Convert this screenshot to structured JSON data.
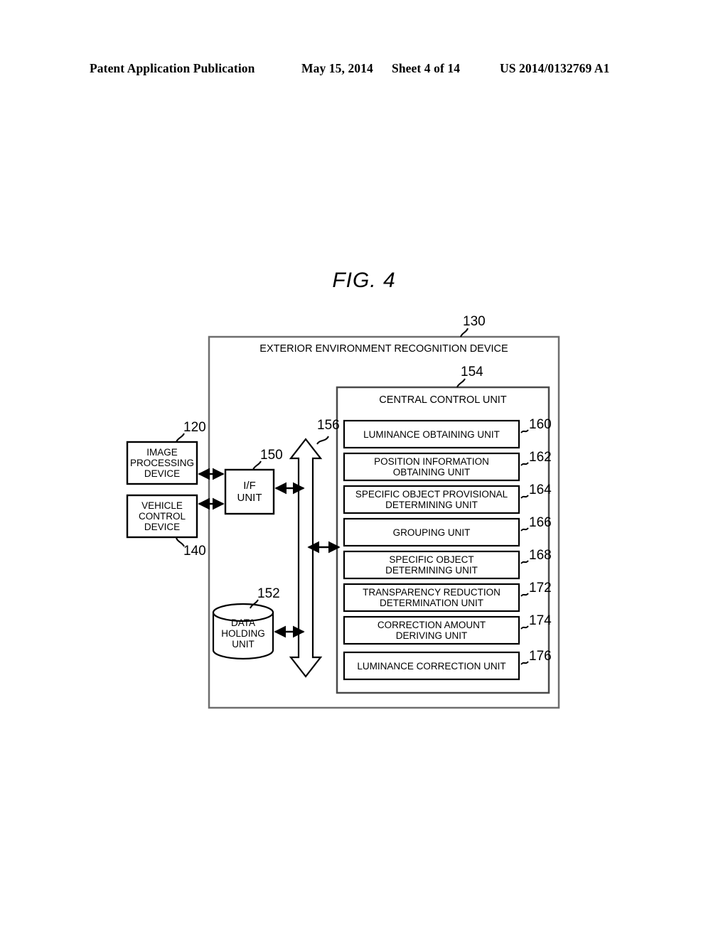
{
  "header": {
    "publication": "Patent Application Publication",
    "date": "May 15, 2014",
    "sheet": "Sheet 4 of 14",
    "patent_number": "US 2014/0132769 A1"
  },
  "figure": {
    "title": "FIG. 4",
    "outer_device": {
      "label": "EXTERIOR ENVIRONMENT RECOGNITION DEVICE",
      "ref": "130"
    },
    "external_blocks": [
      {
        "label": "IMAGE\nPROCESSING\nDEVICE",
        "ref": "120"
      },
      {
        "label": "VEHICLE\nCONTROL\nDEVICE",
        "ref": "140"
      }
    ],
    "interface": {
      "label": "I/F\nUNIT",
      "ref": "150"
    },
    "storage": {
      "label": "DATA\nHOLDING\nUNIT",
      "ref": "152"
    },
    "bus": {
      "ref": "156"
    },
    "central_control_unit": {
      "label": "CENTRAL CONTROL UNIT",
      "ref": "154",
      "units": [
        {
          "label": "LUMINANCE OBTAINING UNIT",
          "ref": "160"
        },
        {
          "label": "POSITION INFORMATION\nOBTAINING UNIT",
          "ref": "162"
        },
        {
          "label": "SPECIFIC OBJECT PROVISIONAL\nDETERMINING UNIT",
          "ref": "164"
        },
        {
          "label": "GROUPING UNIT",
          "ref": "166"
        },
        {
          "label": "SPECIFIC OBJECT\nDETERMINING UNIT",
          "ref": "168"
        },
        {
          "label": "TRANSPARENCY REDUCTION\nDETERMINATION UNIT",
          "ref": "172"
        },
        {
          "label": "CORRECTION AMOUNT\nDERIVING UNIT",
          "ref": "174"
        },
        {
          "label": "LUMINANCE CORRECTION UNIT",
          "ref": "176"
        }
      ]
    },
    "colors": {
      "ink": "#000000",
      "paper": "#ffffff",
      "outer_frame": "#6e6e6e"
    }
  }
}
